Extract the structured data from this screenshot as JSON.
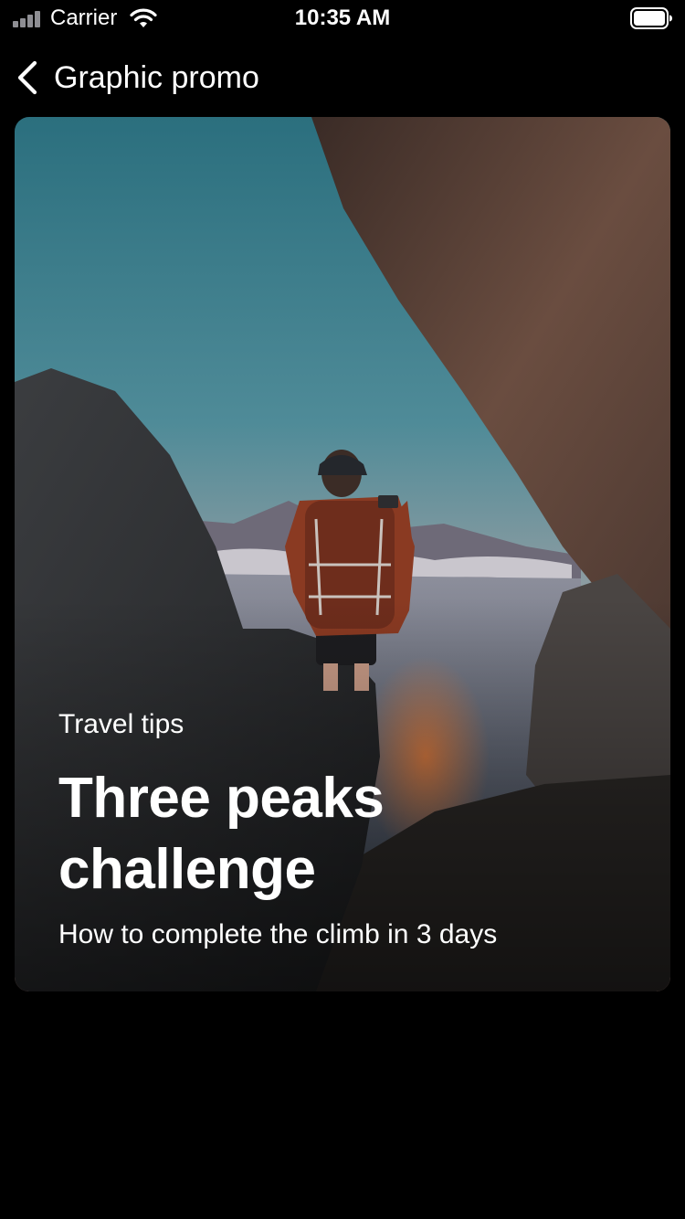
{
  "status_bar": {
    "carrier": "Carrier",
    "time": "10:35 AM",
    "signal_icon": "signal-bars-icon",
    "wifi_icon": "wifi-icon",
    "battery_icon": "battery-icon"
  },
  "nav": {
    "back_icon": "chevron-left-icon",
    "title": "Graphic promo"
  },
  "promo": {
    "eyebrow": "Travel tips",
    "headline_line1": "Three peaks",
    "headline_line2": "challenge",
    "subtitle": "How to complete the climb in 3 days"
  },
  "colors": {
    "background": "#000000",
    "text": "#ffffff",
    "sky_top": "#2a6f7d",
    "sky_bottom": "#d59a86",
    "jacket": "#8a3a22"
  }
}
